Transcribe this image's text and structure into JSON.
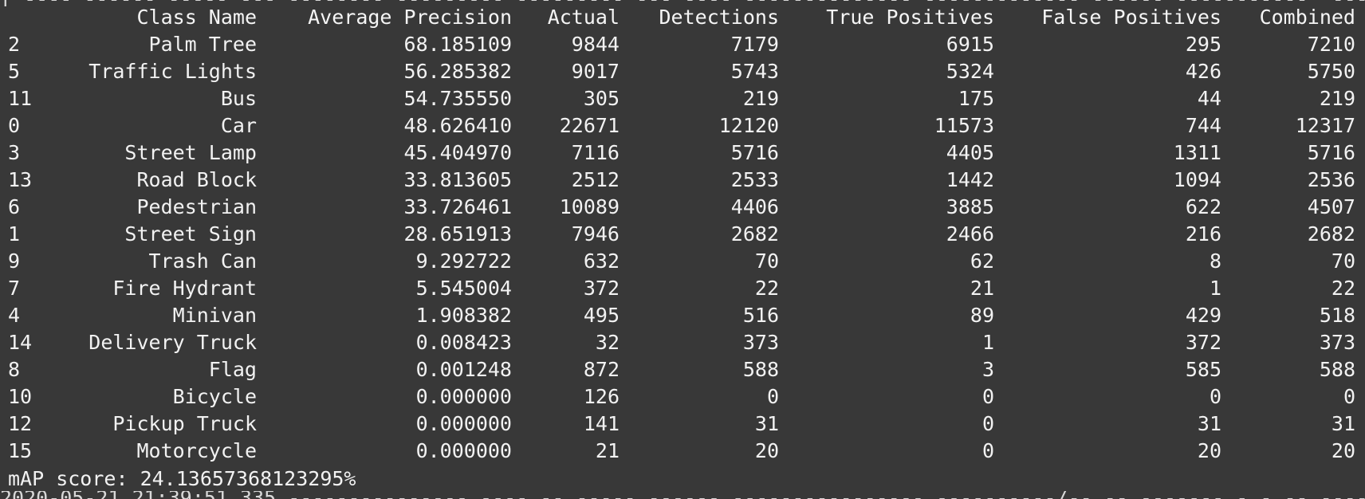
{
  "table": {
    "headers": [
      "",
      "Class Name",
      "Average Precision",
      "Actual",
      "Detections",
      "True Positives",
      "False Positives",
      "Combined"
    ],
    "rows": [
      [
        "2",
        "Palm Tree",
        "68.185109",
        "9844",
        "7179",
        "6915",
        "295",
        "7210"
      ],
      [
        "5",
        "Traffic Lights",
        "56.285382",
        "9017",
        "5743",
        "5324",
        "426",
        "5750"
      ],
      [
        "11",
        "Bus",
        "54.735550",
        "305",
        "219",
        "175",
        "44",
        "219"
      ],
      [
        "0",
        "Car",
        "48.626410",
        "22671",
        "12120",
        "11573",
        "744",
        "12317"
      ],
      [
        "3",
        "Street Lamp",
        "45.404970",
        "7116",
        "5716",
        "4405",
        "1311",
        "5716"
      ],
      [
        "13",
        "Road Block",
        "33.813605",
        "2512",
        "2533",
        "1442",
        "1094",
        "2536"
      ],
      [
        "6",
        "Pedestrian",
        "33.726461",
        "10089",
        "4406",
        "3885",
        "622",
        "4507"
      ],
      [
        "1",
        "Street Sign",
        "28.651913",
        "7946",
        "2682",
        "2466",
        "216",
        "2682"
      ],
      [
        "9",
        "Trash Can",
        "9.292722",
        "632",
        "70",
        "62",
        "8",
        "70"
      ],
      [
        "7",
        "Fire Hydrant",
        "5.545004",
        "372",
        "22",
        "21",
        "1",
        "22"
      ],
      [
        "4",
        "Minivan",
        "1.908382",
        "495",
        "516",
        "89",
        "429",
        "518"
      ],
      [
        "14",
        "Delivery Truck",
        "0.008423",
        "32",
        "373",
        "1",
        "372",
        "373"
      ],
      [
        "8",
        "Flag",
        "0.001248",
        "872",
        "588",
        "3",
        "585",
        "588"
      ],
      [
        "10",
        "Bicycle",
        "0.000000",
        "126",
        "0",
        "0",
        "0",
        "0"
      ],
      [
        "12",
        "Pickup Truck",
        "0.000000",
        "141",
        "31",
        "0",
        "31",
        "31"
      ],
      [
        "15",
        "Motorcycle",
        "0.000000",
        "21",
        "20",
        "0",
        "20",
        "20"
      ]
    ]
  },
  "map_score": "mAP score: 24.13657368123295%",
  "cut_top_text": "[ ---- ------ ----- --- -------- --------- ---------_--- ---- -------------- ------------- ------ -----------  --- -",
  "cut_bottom_text": "2020-05-21 21:39:51.335 --------------- ---- -- ----- ------ ---------------- ----------/-- -- ------- - - -- --------"
}
